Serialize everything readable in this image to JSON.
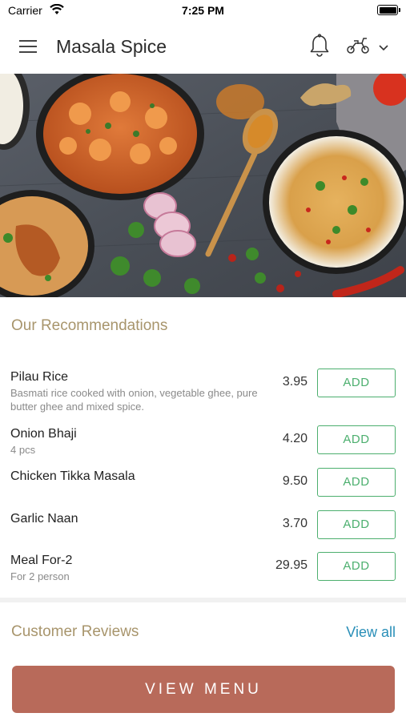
{
  "status_bar": {
    "carrier": "Carrier",
    "time": "7:25 PM"
  },
  "header": {
    "title": "Masala Spice",
    "icons": [
      "menu-icon",
      "bell-icon",
      "scooter-icon",
      "chevron-down-icon"
    ]
  },
  "hero": {
    "image": "indian-food-spread"
  },
  "recommendations": {
    "title": "Our Recommendations",
    "add_label": "ADD",
    "items": [
      {
        "name": "Pilau Rice",
        "description": "Basmati rice cooked with onion, vegetable ghee, pure butter ghee and mixed spice.",
        "price": "3.95"
      },
      {
        "name": "Onion Bhaji",
        "description": "4 pcs",
        "price": "4.20"
      },
      {
        "name": "Chicken Tikka Masala",
        "description": "",
        "price": "9.50"
      },
      {
        "name": "Garlic Naan",
        "description": "",
        "price": "3.70"
      },
      {
        "name": "Meal For-2",
        "description": "For 2 person",
        "price": "29.95"
      }
    ]
  },
  "reviews": {
    "title": "Customer Reviews",
    "view_all": "View all"
  },
  "footer": {
    "view_menu": "VIEW MENU"
  },
  "colors": {
    "accent_gold": "#a8956c",
    "add_green": "#4caf6e",
    "link_blue": "#2a8fb8",
    "menu_button": "#b86a5a"
  }
}
